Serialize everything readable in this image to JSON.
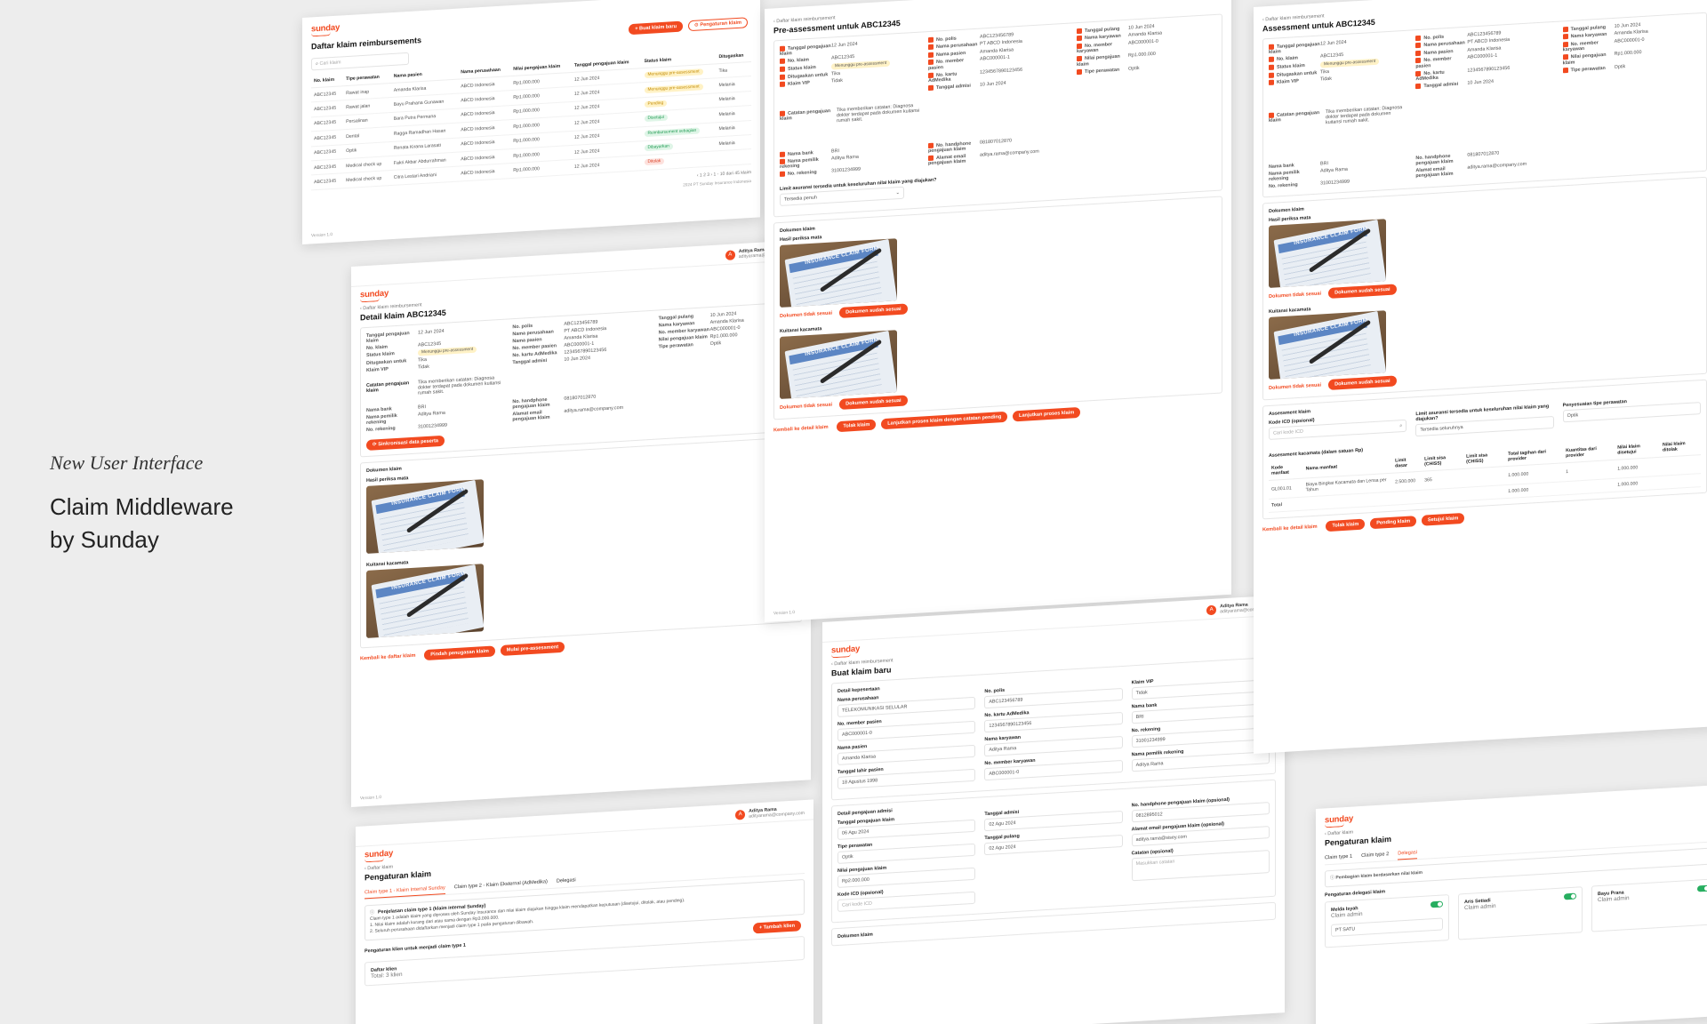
{
  "hero": {
    "subtitle": "New User Interface",
    "title_line1": "Claim Middleware",
    "title_line2": "by Sunday"
  },
  "brand": {
    "logo": "sunday",
    "accent": "#f24a20"
  },
  "common": {
    "version": "Version 1.0",
    "copyright": "2024 PT Sunday Insurance Indonesia",
    "user_name": "Aditya Rama",
    "user_email": "adityarama@company.com",
    "back_label": "Kembali ke detail klaim"
  },
  "list_page": {
    "title": "Daftar klaim reimbursements",
    "new_button": "Buat klaim baru",
    "settings_button": "Pengaturan klaim",
    "search_placeholder": "Cari klaim",
    "columns": [
      "No. klaim",
      "Tipe perawatan",
      "Nama pasien",
      "Nama perusahaan",
      "Nilai pengajuan klaim",
      "Tanggal pengajuan klaim",
      "Status klaim",
      "Ditugaskan"
    ],
    "rows": [
      [
        "ABC12345",
        "Rawat inap",
        "Amanda Klarisa",
        "ABCD Indonesia",
        "Rp1.000.000",
        "12 Jun 2024",
        "Menunggu pre-assessment",
        "Tika"
      ],
      [
        "ABC12345",
        "Rawat jalan",
        "Bayu Prahana Gunawan",
        "ABCD Indonesia",
        "Rp1.000.000",
        "12 Jun 2024",
        "Menunggu pre-assessment",
        "Melania"
      ],
      [
        "ABC12345",
        "Persalinan",
        "Bara Putra Permana",
        "ABCD Indonesia",
        "Rp1.000.000",
        "12 Jun 2024",
        "Pending",
        "Melania"
      ],
      [
        "ABC12345",
        "Dental",
        "Ragga Ramadhan Hasan",
        "ABCD Indonesia",
        "Rp1.000.000",
        "12 Jun 2024",
        "Disetujui",
        "Melania"
      ],
      [
        "ABC12345",
        "Optik",
        "Renata Kirana Larasati",
        "ABCD Indonesia",
        "Rp1.000.000",
        "12 Jun 2024",
        "Reimbursement sebagian",
        "Melania"
      ],
      [
        "ABC12345",
        "Medical check up",
        "Fakri Akbar Abdurrahman",
        "ABCD Indonesia",
        "Rp1.000.000",
        "12 Jun 2024",
        "Dibayarkan",
        "Melania"
      ],
      [
        "ABC12345",
        "Medical check up",
        "Citra Lestari Andriani",
        "ABCD Indonesia",
        "Rp1.000.000",
        "12 Jun 2024",
        "Ditolak",
        ""
      ]
    ],
    "pagination": "1 - 10 dari 45 klaim"
  },
  "detail_page": {
    "breadcrumb": "Daftar klaim reimbursement",
    "title": "Detail klaim ABC12345",
    "fields_col1": [
      [
        "Tanggal pengajuan klaim",
        "12 Jun 2024"
      ],
      [
        "No. klaim",
        "ABC12345"
      ],
      [
        "Status klaim",
        "Menunggu pre-assessment"
      ],
      [
        "Ditugaskan untuk",
        "Tika"
      ],
      [
        "Klaim VIP",
        "Tidak"
      ]
    ],
    "fields_col2": [
      [
        "No. polis",
        "ABC123456789"
      ],
      [
        "Nama perusahaan",
        "PT ABCD Indonesia"
      ],
      [
        "Nama pasien",
        "Amanda Klarisa"
      ],
      [
        "No. member pasien",
        "ABC000001-1"
      ],
      [
        "No. kartu AdMedika",
        "1234567890123456"
      ],
      [
        "Tanggal admisi",
        "10 Jun 2024"
      ]
    ],
    "fields_col3": [
      [
        "Tanggal pulang",
        "10 Jun 2024"
      ],
      [
        "Nama karyawan",
        "Amanda Klarisa"
      ],
      [
        "No. member karyawan",
        "ABC000001-0"
      ],
      [
        "Nilai pengajuan klaim",
        "Rp1.000.000"
      ],
      [
        "Tipe perawatan",
        "Optik"
      ]
    ],
    "notes_label": "Catatan pengajuan klaim",
    "notes": "Tika memberikan catatan: Diagnosa dokter terdapat pada dokumen kuitansi rumah sakit.",
    "bank": [
      [
        "Nama bank",
        "BRI"
      ],
      [
        "Nama pemilik rekening",
        "Aditya Rama"
      ],
      [
        "No. rekening",
        "31001234999"
      ]
    ],
    "contact": [
      [
        "No. handphone pengajuan klaim",
        "081807012870"
      ],
      [
        "Alamat email pengajuan klaim",
        "aditya.rama@company.com"
      ]
    ],
    "sync_button": "Sinkronisasi data peserta",
    "docs_title": "Dokumen klaim",
    "doc1": "Hasil periksa mata",
    "doc2": "Kuitansi kacamata",
    "doc_image_text": "INSURANCE CLAIM FORM",
    "back_button": "Kembali ke daftar klaim",
    "move_button": "Pindah penugasan klaim",
    "start_button": "Mulai pre-assessment"
  },
  "pre_page": {
    "title": "Pre-assessment untuk ABC12345",
    "limit_label": "Limit asuransi tersedia untuk keseluruhan nilai klaim yang diajukan?",
    "limit_value": "Tersedia penuh",
    "doc_mismatch": "Dokumen tidak sesuai",
    "doc_match": "Dokumen sudah sesuai",
    "reject": "Tolak klaim",
    "continue_pending": "Lanjutkan proses klaim dengan catatan pending",
    "continue": "Lanjutkan proses klaim"
  },
  "assess_page": {
    "title": "Assessment untuk ABC12345",
    "section": "Assessment klaim",
    "icd_label": "Kode ICD (opsional)",
    "icd_placeholder": "Cari kode ICD",
    "limit_label": "Limit asuransi tersedia untuk keseluruhan nilai klaim yang diajukan?",
    "limit_value": "Tersedia seluruhnya",
    "type_label": "Penyesuaian tipe perawatan",
    "type_value": "Optik",
    "table_title": "Assessment kacamata (dalam satuan Rp)",
    "columns": [
      "Kode manfaat",
      "Nama manfaat",
      "Limit dasar",
      "Limit sisa (CHISS)",
      "Limit sisa (CHISS)",
      "Total tagihan dari provider",
      "Kuantitas dari provider",
      "Nilai klaim disetujui",
      "Nilai klaim ditolak"
    ],
    "row_code": "GL001.01",
    "row_name": "Biaya Bingkai Kacamata dan Lensa per Tahun",
    "row_values": [
      "2.500.000",
      "365",
      "1.000.000",
      "1",
      "1.000.000",
      ""
    ],
    "total_label": "Total",
    "total_value": "1.000.000",
    "pending": "Pending klaim",
    "approve": "Setujui klaim"
  },
  "new_page": {
    "breadcrumb": "Daftar klaim reimbursement",
    "title": "Buat klaim baru",
    "section1": "Detail kepesertaan",
    "company_label": "Nama perusahaan",
    "company_value": "TELEKOMUNIKASI SELULAR",
    "policy_label": "No. polis",
    "policy_value": "ABC123456789",
    "vip_label": "Klaim VIP",
    "vip_value": "Tidak",
    "member_label": "No. member pasien",
    "member_value": "ABC000001-0",
    "card_label": "No. kartu AdMedika",
    "card_value": "1234567890123456",
    "bank_label": "Nama bank",
    "bank_value": "BRI",
    "patient_label": "Nama pasien",
    "patient_value": "Amanda Klarisa",
    "employee_label": "Nama karyawan",
    "employee_value": "Aditya Rama",
    "account_label": "No. rekening",
    "account_value": "31001234999",
    "dob_label": "Tanggal lahir pasien",
    "dob_value": "18 Agustus 1998",
    "emp_member_label": "No. member karyawan",
    "emp_member_value": "ABC000001-0",
    "owner_label": "Nama pemilik rekening",
    "owner_value": "Aditya Rama",
    "section2": "Detail pengajuan admisi",
    "submit_date_label": "Tanggal pengajuan klaim",
    "submit_date_value": "06 Agu 2024",
    "admit_label": "Tanggal admisi",
    "admit_value": "02 Agu 2024",
    "phone_label": "No. handphone pengajuan klaim (opsional)",
    "phone_value": "0812895012",
    "type_label": "Tipe perawatan",
    "type_value": "Optik",
    "discharge_label": "Tanggal pulang",
    "discharge_value": "02 Agu 2024",
    "email_label": "Alamat email pengajuan klaim (opsional)",
    "email_value": "aditya.rama@sisey.com",
    "amount_label": "Nilai pengajuan klaim",
    "amount_value": "Rp2.000.000",
    "note_label": "Catatan (opsional)",
    "note_placeholder": "Masukkan catatan",
    "icd_label": "Kode ICD (opsional)",
    "icd_placeholder": "Cari kode ICD",
    "docs": "Dokumen klaim"
  },
  "settings_page": {
    "breadcrumb": "Daftar klaim",
    "title": "Pengaturan klaim",
    "tabs": [
      "Claim type 1 - Klaim Internal Sunday",
      "Claim type 2 - Klaim Eksternal (AdMedika)",
      "Delegasi"
    ],
    "info_title": "Penjelasan claim type 1 (klaim internal Sunday)",
    "info_text": "Claim type 1 adalah klaim yang diproses oleh Sunday Insurance dan nilai klaim diajukan hingga klaim mendapatkan keputusan (disetujui, ditolak, atau pending).",
    "rule1": "1. Nilai klaim adalah kurang dari atau sama dengan Rp3.000.000.",
    "rule2": "2. Seluruh perusahaan didaftarkan menjadi claim type 1 pada pengaturan dibawah.",
    "client_title": "Pengaturan klien untuk menjadi claim type 1",
    "add_button": "+ Tambah klien",
    "list_title": "Daftar klien",
    "list_count": "Total: 3 klien"
  },
  "delegation_page": {
    "breadcrumb": "Daftar klaim",
    "title": "Pengaturan klaim",
    "tabs": [
      "Claim type 1",
      "Claim type 2",
      "Delegasi"
    ],
    "info_title": "Pembagian klaim berdasarkan nilai klaim",
    "section": "Pengaturan delegasi klaim",
    "people": [
      {
        "name": "Melda Isyah",
        "role": "Claim admin"
      },
      {
        "name": "Aris Setiadi",
        "role": "Claim admin"
      },
      {
        "name": "Bayu Prana",
        "role": "Claim admin"
      }
    ],
    "company": "PT SATU"
  }
}
